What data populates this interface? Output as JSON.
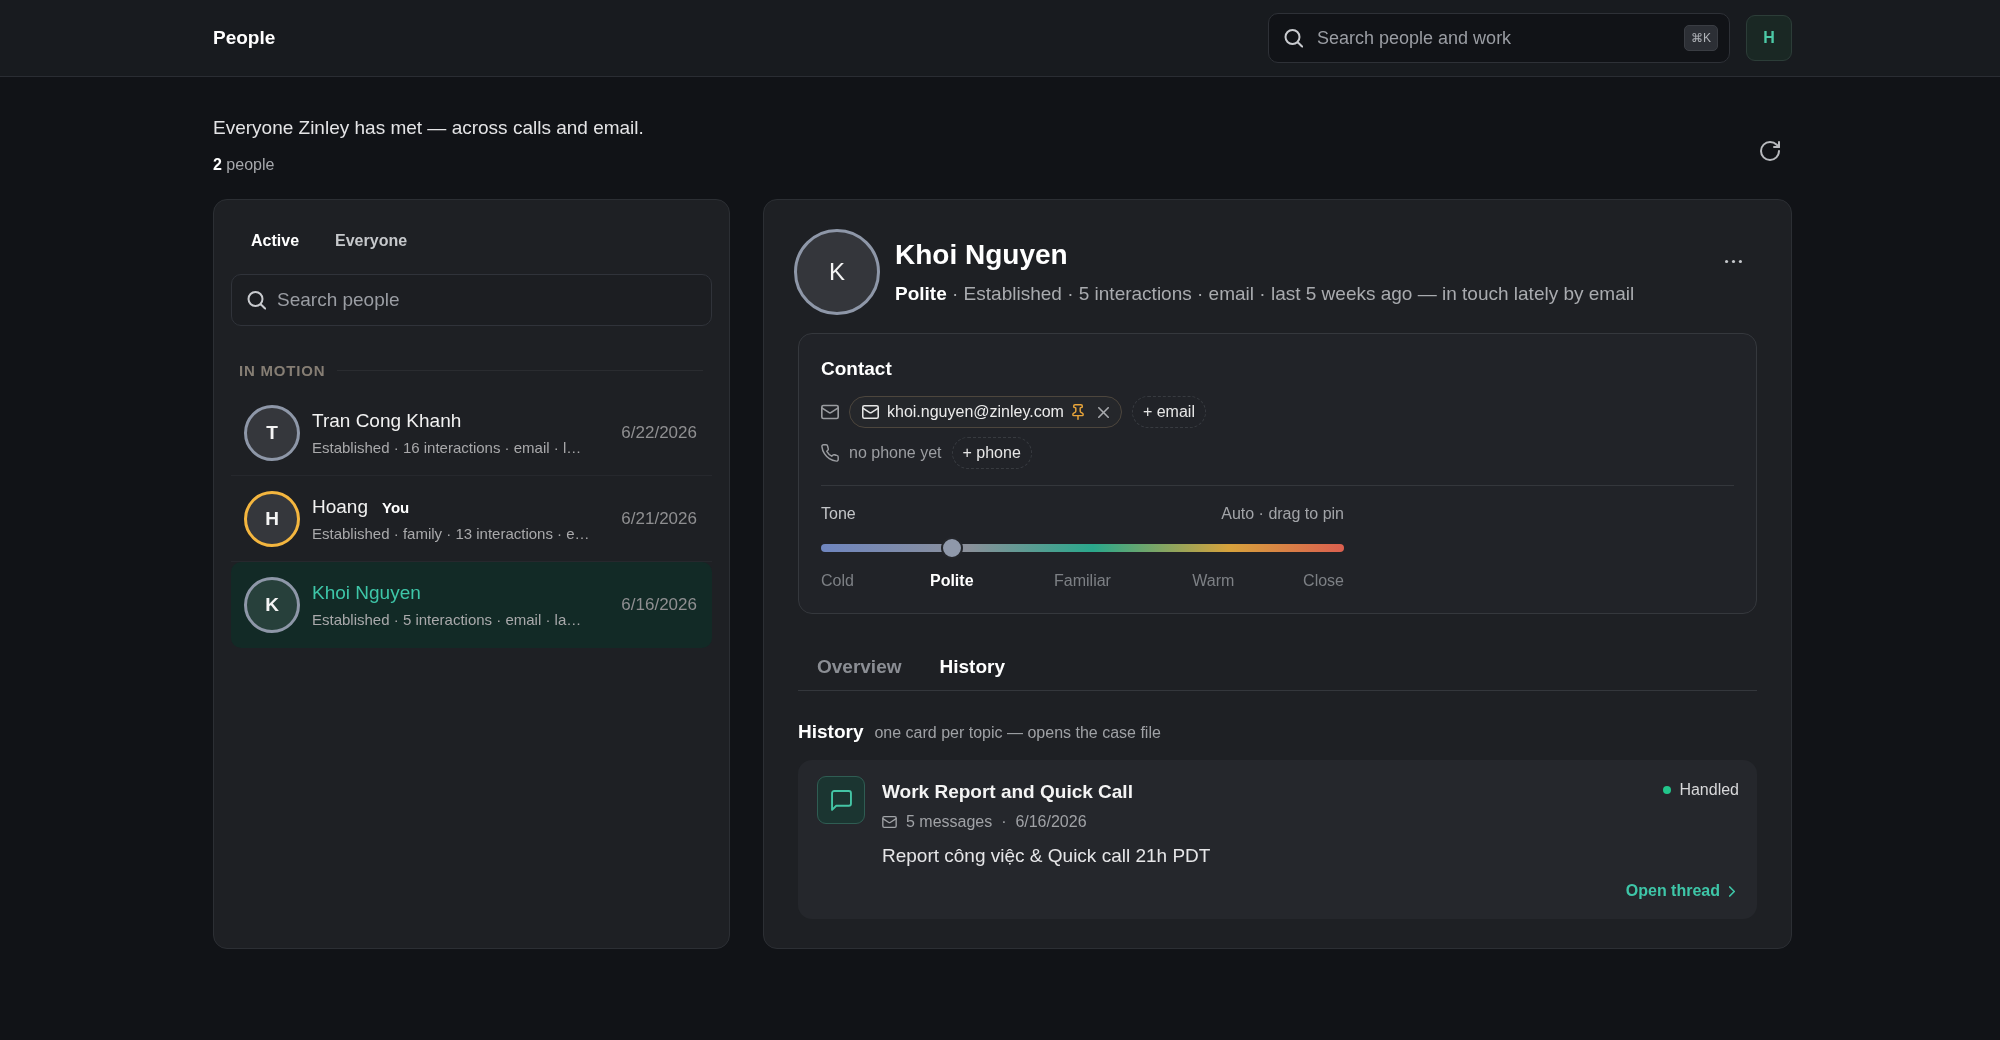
{
  "header": {
    "title": "People",
    "search": {
      "placeholder": "Search people and work",
      "shortcut": "⌘K"
    },
    "user_initial": "H"
  },
  "intro": {
    "text": "Everyone Zinley has met — across calls and email.",
    "count": "**2** people"
  },
  "people_panel": {
    "tabs": [
      {
        "label": "Active",
        "selected": true
      },
      {
        "label": "Everyone",
        "selected": false
      }
    ],
    "search": {
      "placeholder": "Search people"
    },
    "section": "IN MOTION",
    "people": [
      {
        "initial": "T",
        "name": "Tran Cong Khanh",
        "summary": "Established · 16 interactions · email · l…",
        "date": "6/22/2026",
        "color": "#8e97a8",
        "selected": false
      },
      {
        "initial": "H",
        "name": "Hoang",
        "badge": "You",
        "summary": "Established · family · 13 interactions · e…",
        "date": "6/21/2026",
        "color": "#f4b63f",
        "selected": false
      },
      {
        "initial": "K",
        "name": "Khoi Nguyen",
        "summary": "Established · 5 interactions · email · la…",
        "date": "6/16/2026",
        "color": "#8e97a8",
        "selected": true
      }
    ]
  },
  "profile": {
    "initial": "K",
    "name": "Khoi Nguyen",
    "summary": "**Polite** · Established · 5 interactions · email · last 5 weeks ago — in touch lately by email",
    "contact": {
      "title": "Contact",
      "emails": [
        {
          "address": "khoi.nguyen@zinley.com",
          "pinned": true
        }
      ],
      "add_email": "+ email",
      "phone_empty": "no phone yet",
      "add_phone": "+ phone"
    },
    "tone": {
      "label": "Tone",
      "hint": "Auto · drag to pin",
      "level": 0.25,
      "stops": [
        {
          "label": "Cold",
          "selected": false
        },
        {
          "label": "Polite",
          "selected": true
        },
        {
          "label": "Familiar",
          "selected": false
        },
        {
          "label": "Warm",
          "selected": false
        },
        {
          "label": "Close",
          "selected": false
        }
      ]
    },
    "tabs": [
      {
        "label": "Overview",
        "selected": false
      },
      {
        "label": "History",
        "selected": true
      }
    ],
    "history": {
      "title": "History",
      "subtitle": "one card per topic — opens the case file",
      "items": [
        {
          "title": "Work Report and Quick Call",
          "meta": "5 messages  ·  6/16/2026",
          "preview": "Report công việc & Quick call 21h PDT",
          "status": "Handled",
          "color": "#22c58b",
          "action": "Open thread"
        }
      ]
    }
  }
}
